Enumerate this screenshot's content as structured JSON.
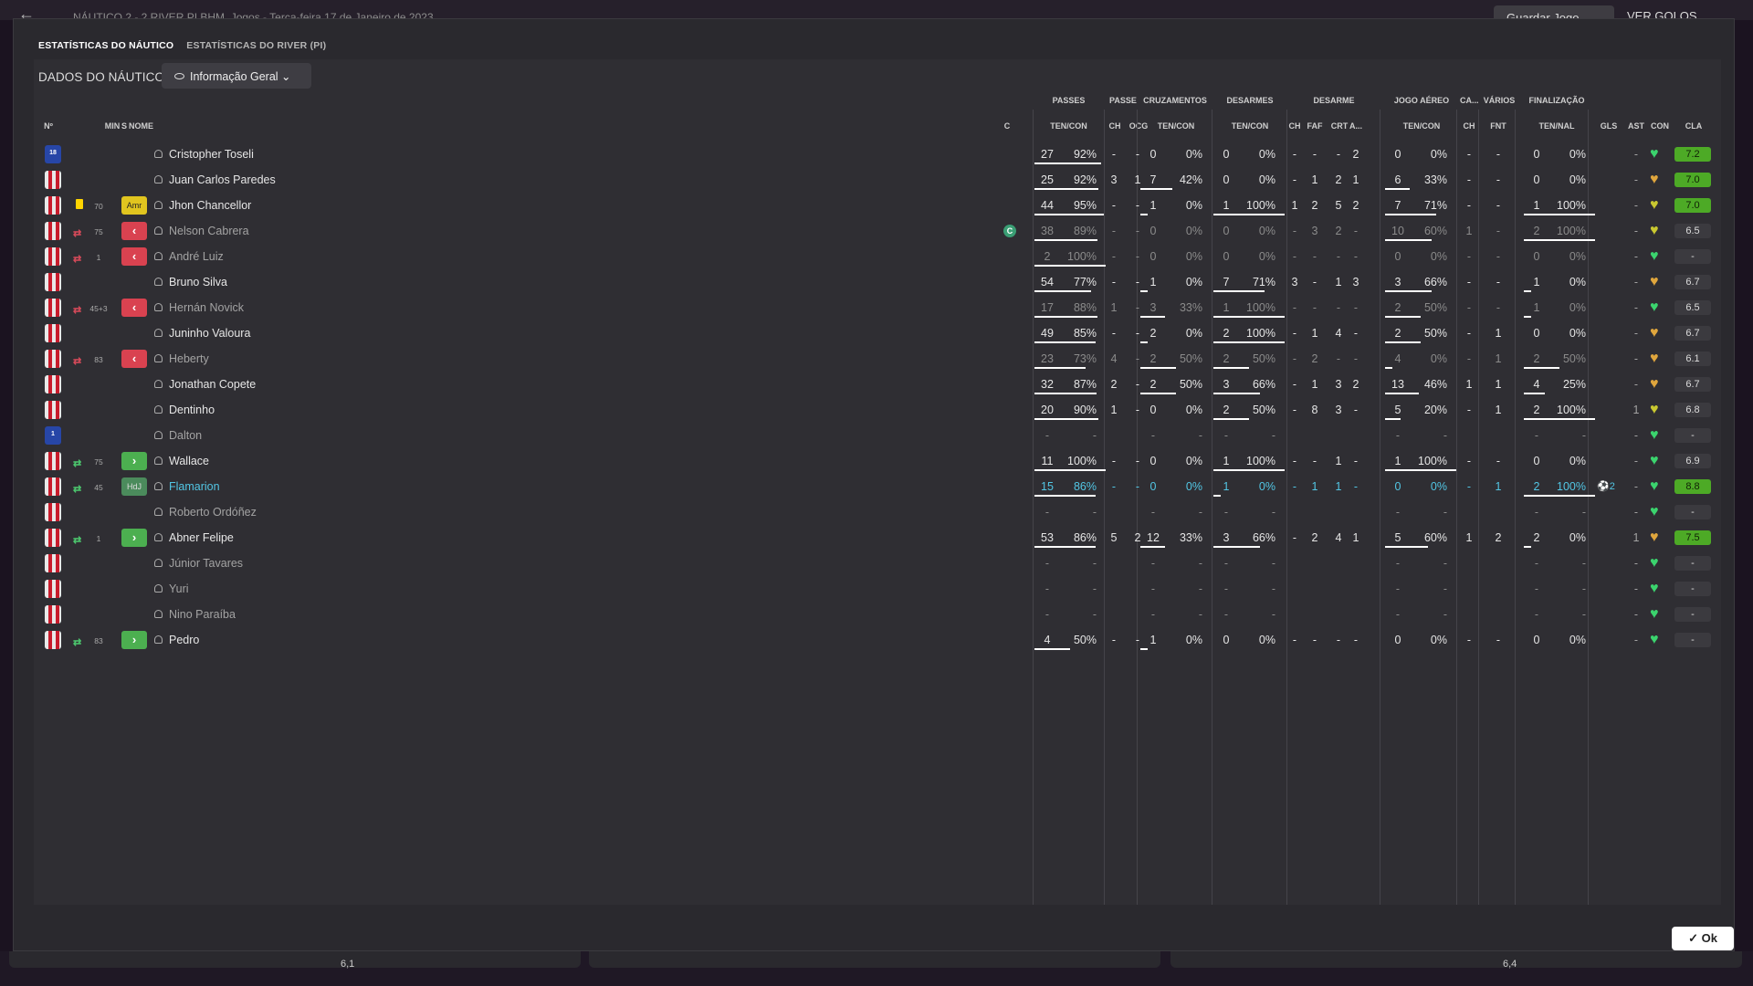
{
  "topbar": {
    "back": "←",
    "match": "NÁUTICO  2 - 2  RIVER PI   BHM, Jogos  -  Terça-feira 17 de Janeiro de 2023",
    "save": "Guardar Jogo",
    "goals": "VER GOLOS"
  },
  "tabs": [
    {
      "label": "ESTATÍSTICAS DO NÁUTICO",
      "active": true
    },
    {
      "label": "ESTATÍSTICAS DO RIVER (PI)",
      "active": false
    }
  ],
  "section_title": "DADOS DO NÁUTICO",
  "view_select": "Informação Geral",
  "group_headers": [
    "PASSES",
    "PASSE",
    "CRUZAMENTOS",
    "DESARMES",
    "DESARME",
    "JOGO AÉREO",
    "CA...",
    "VÁRIOS",
    "FINALIZAÇÃO"
  ],
  "column_headers": [
    "Nº",
    "MIN",
    "S",
    "NOME",
    "C",
    "TEN/CON",
    "CH",
    "OCG",
    "TEN/CON",
    "TEN/CON",
    "CH",
    "FAF",
    "CRT",
    "A...",
    "TEN/CON",
    "CH",
    "FNT",
    "TEN/NAL",
    "GLS",
    "AST",
    "CON",
    "CLA"
  ],
  "players": [
    {
      "num": "18",
      "gk": true,
      "name": "Cristopher Toseli",
      "dim": false,
      "card": "",
      "sub": "",
      "min": "",
      "badge": "",
      "cap": false,
      "pas": [
        "27",
        "92%",
        0.93
      ],
      "ch": "-",
      "ocg": "-",
      "cru": [
        "0",
        "0%",
        0
      ],
      "des": [
        "0",
        "0%",
        0
      ],
      "dch": "-",
      "faf": "-",
      "crt": "-",
      "a": "2",
      "aer": [
        "0",
        "0%",
        0
      ],
      "cach": "-",
      "fnt": "-",
      "fin": [
        "0",
        "0%",
        0
      ],
      "gls": "",
      "ast": "-",
      "heart": "g",
      "cla": "7.2",
      "hi": true
    },
    {
      "num": "",
      "gk": false,
      "name": "Juan Carlos Paredes",
      "dim": false,
      "card": "",
      "sub": "",
      "min": "",
      "badge": "",
      "cap": false,
      "pas": [
        "25",
        "92%",
        0.9
      ],
      "ch": "3",
      "ocg": "1",
      "cru": [
        "7",
        "42%",
        0.45
      ],
      "des": [
        "0",
        "0%",
        0
      ],
      "dch": "-",
      "faf": "1",
      "crt": "2",
      "a": "1",
      "aer": [
        "6",
        "33%",
        0.35
      ],
      "cach": "-",
      "fnt": "-",
      "fin": [
        "0",
        "0%",
        0
      ],
      "gls": "",
      "ast": "-",
      "heart": "o",
      "cla": "7.0",
      "hi": true
    },
    {
      "num": "",
      "gk": false,
      "name": "Jhon Chancellor",
      "dim": false,
      "card": "y",
      "sub": "",
      "min": "70",
      "badge": "Amr",
      "cap": false,
      "pas": [
        "44",
        "95%",
        0.97
      ],
      "ch": "-",
      "ocg": "-",
      "cru": [
        "1",
        "0%",
        0.1
      ],
      "des": [
        "1",
        "100%",
        1
      ],
      "dch": "1",
      "faf": "2",
      "crt": "5",
      "a": "2",
      "aer": [
        "7",
        "71%",
        0.72
      ],
      "cach": "-",
      "fnt": "-",
      "fin": [
        "1",
        "100%",
        1
      ],
      "gls": "",
      "ast": "-",
      "heart": "y",
      "cla": "7.0",
      "hi": true
    },
    {
      "num": "",
      "gk": false,
      "name": "Nelson Cabrera",
      "dim": true,
      "card": "",
      "sub": "out",
      "min": "75",
      "badge": "<",
      "cap": true,
      "pas": [
        "38",
        "89%",
        0.88
      ],
      "ch": "-",
      "ocg": "-",
      "cru": [
        "0",
        "0%",
        0
      ],
      "des": [
        "0",
        "0%",
        0
      ],
      "dch": "-",
      "faf": "3",
      "crt": "2",
      "a": "-",
      "aer": [
        "10",
        "60%",
        0.65
      ],
      "cach": "1",
      "fnt": "-",
      "fin": [
        "2",
        "100%",
        1
      ],
      "gls": "",
      "ast": "-",
      "heart": "y",
      "cla": "6.5",
      "hi": false
    },
    {
      "num": "",
      "gk": false,
      "name": "André Luiz",
      "dim": true,
      "card": "",
      "sub": "out",
      "min": "1",
      "badge": "<",
      "cap": false,
      "pas": [
        "2",
        "100%",
        1
      ],
      "ch": "-",
      "ocg": "-",
      "cru": [
        "0",
        "0%",
        0
      ],
      "des": [
        "0",
        "0%",
        0
      ],
      "dch": "-",
      "faf": "-",
      "crt": "-",
      "a": "-",
      "aer": [
        "0",
        "0%",
        0
      ],
      "cach": "-",
      "fnt": "-",
      "fin": [
        "0",
        "0%",
        0
      ],
      "gls": "",
      "ast": "-",
      "heart": "g",
      "cla": "-",
      "hi": false
    },
    {
      "num": "",
      "gk": false,
      "name": "Bruno Silva",
      "dim": false,
      "card": "",
      "sub": "",
      "min": "",
      "badge": "",
      "cap": false,
      "pas": [
        "54",
        "77%",
        0.8
      ],
      "ch": "-",
      "ocg": "-",
      "cru": [
        "1",
        "0%",
        0.1
      ],
      "des": [
        "7",
        "71%",
        0.72
      ],
      "dch": "3",
      "faf": "-",
      "crt": "1",
      "a": "3",
      "aer": [
        "3",
        "66%",
        0.66
      ],
      "cach": "-",
      "fnt": "-",
      "fin": [
        "1",
        "0%",
        0.1
      ],
      "gls": "",
      "ast": "-",
      "heart": "o",
      "cla": "6.7",
      "hi": false
    },
    {
      "num": "",
      "gk": false,
      "name": "Hernán Novick",
      "dim": true,
      "card": "",
      "sub": "out",
      "min": "45+3",
      "badge": "<",
      "cap": false,
      "pas": [
        "17",
        "88%",
        0.88
      ],
      "ch": "1",
      "ocg": "-",
      "cru": [
        "3",
        "33%",
        0.35
      ],
      "des": [
        "1",
        "100%",
        1
      ],
      "dch": "-",
      "faf": "-",
      "crt": "-",
      "a": "-",
      "aer": [
        "2",
        "50%",
        0.5
      ],
      "cach": "-",
      "fnt": "-",
      "fin": [
        "1",
        "0%",
        0.1
      ],
      "gls": "",
      "ast": "-",
      "heart": "g",
      "cla": "6.5",
      "hi": false
    },
    {
      "num": "",
      "gk": false,
      "name": "Juninho Valoura",
      "dim": false,
      "card": "",
      "sub": "",
      "min": "",
      "badge": "",
      "cap": false,
      "pas": [
        "49",
        "85%",
        0.86
      ],
      "ch": "-",
      "ocg": "-",
      "cru": [
        "2",
        "0%",
        0.1
      ],
      "des": [
        "2",
        "100%",
        1
      ],
      "dch": "-",
      "faf": "1",
      "crt": "4",
      "a": "-",
      "aer": [
        "2",
        "50%",
        0.5
      ],
      "cach": "-",
      "fnt": "1",
      "fin": [
        "0",
        "0%",
        0
      ],
      "gls": "",
      "ast": "-",
      "heart": "o",
      "cla": "6.7",
      "hi": false
    },
    {
      "num": "",
      "gk": false,
      "name": "Heberty",
      "dim": true,
      "card": "",
      "sub": "out",
      "min": "83",
      "badge": "<",
      "cap": false,
      "pas": [
        "23",
        "73%",
        0.72
      ],
      "ch": "4",
      "ocg": "-",
      "cru": [
        "2",
        "50%",
        0.5
      ],
      "des": [
        "2",
        "50%",
        0.5
      ],
      "dch": "-",
      "faf": "2",
      "crt": "-",
      "a": "-",
      "aer": [
        "4",
        "0%",
        0.1
      ],
      "cach": "-",
      "fnt": "1",
      "fin": [
        "2",
        "50%",
        0.5
      ],
      "gls": "",
      "ast": "-",
      "heart": "o",
      "cla": "6.1",
      "hi": false
    },
    {
      "num": "",
      "gk": false,
      "name": "Jonathan Copete",
      "dim": false,
      "card": "",
      "sub": "",
      "min": "",
      "badge": "",
      "cap": false,
      "pas": [
        "32",
        "87%",
        0.87
      ],
      "ch": "2",
      "ocg": "-",
      "cru": [
        "2",
        "50%",
        0.5
      ],
      "des": [
        "3",
        "66%",
        0.66
      ],
      "dch": "-",
      "faf": "1",
      "crt": "3",
      "a": "2",
      "aer": [
        "13",
        "46%",
        0.47
      ],
      "cach": "1",
      "fnt": "1",
      "fin": [
        "4",
        "25%",
        0.3
      ],
      "gls": "",
      "ast": "-",
      "heart": "o",
      "cla": "6.7",
      "hi": false
    },
    {
      "num": "",
      "gk": false,
      "name": "Dentinho",
      "dim": false,
      "card": "",
      "sub": "",
      "min": "",
      "badge": "",
      "cap": false,
      "pas": [
        "20",
        "90%",
        0.9
      ],
      "ch": "1",
      "ocg": "-",
      "cru": [
        "0",
        "0%",
        0
      ],
      "des": [
        "2",
        "50%",
        0.5
      ],
      "dch": "-",
      "faf": "8",
      "crt": "3",
      "a": "-",
      "aer": [
        "5",
        "20%",
        0.22
      ],
      "cach": "-",
      "fnt": "1",
      "fin": [
        "2",
        "100%",
        1
      ],
      "gls": "",
      "ast": "1",
      "heart": "y",
      "cla": "6.8",
      "hi": false
    },
    {
      "num": "1",
      "gk": true,
      "name": "Dalton",
      "dim": true,
      "card": "",
      "sub": "",
      "min": "",
      "badge": "",
      "cap": false,
      "pas": [
        "-",
        "-",
        0
      ],
      "ch": "",
      "ocg": "",
      "cru": [
        "-",
        "-",
        0
      ],
      "des": [
        "-",
        "-",
        0
      ],
      "dch": "",
      "faf": "",
      "crt": "",
      "a": "",
      "aer": [
        "-",
        "-",
        0
      ],
      "cach": "",
      "fnt": "",
      "fin": [
        "-",
        "-",
        0
      ],
      "gls": "",
      "ast": "-",
      "heart": "g",
      "cla": "-",
      "hi": false
    },
    {
      "num": "",
      "gk": false,
      "name": "Wallace",
      "dim": false,
      "card": "",
      "sub": "in",
      "min": "75",
      "badge": ">",
      "cap": false,
      "pas": [
        "11",
        "100%",
        1
      ],
      "ch": "-",
      "ocg": "-",
      "cru": [
        "0",
        "0%",
        0
      ],
      "des": [
        "1",
        "100%",
        1
      ],
      "dch": "-",
      "faf": "-",
      "crt": "1",
      "a": "-",
      "aer": [
        "1",
        "100%",
        1
      ],
      "cach": "-",
      "fnt": "-",
      "fin": [
        "0",
        "0%",
        0
      ],
      "gls": "",
      "ast": "-",
      "heart": "g",
      "cla": "6.9",
      "hi": false
    },
    {
      "num": "",
      "gk": false,
      "name": "Flamarion",
      "dim": false,
      "cyan": true,
      "card": "",
      "sub": "in",
      "min": "45",
      "badge": "HdJ",
      "cap": false,
      "pas": [
        "15",
        "86%",
        0.86
      ],
      "ch": "-",
      "ocg": "-",
      "cru": [
        "0",
        "0%",
        0
      ],
      "des": [
        "1",
        "0%",
        0.1
      ],
      "dch": "-",
      "faf": "1",
      "crt": "1",
      "a": "-",
      "aer": [
        "0",
        "0%",
        0
      ],
      "cach": "-",
      "fnt": "1",
      "fin": [
        "2",
        "100%",
        1
      ],
      "gls": "⚽2",
      "ast": "-",
      "heart": "g",
      "cla": "8.8",
      "hi": true
    },
    {
      "num": "",
      "gk": false,
      "name": "Roberto Ordóñez",
      "dim": true,
      "card": "",
      "sub": "",
      "min": "",
      "badge": "",
      "cap": false,
      "pas": [
        "-",
        "-",
        0
      ],
      "ch": "",
      "ocg": "",
      "cru": [
        "-",
        "-",
        0
      ],
      "des": [
        "-",
        "-",
        0
      ],
      "dch": "",
      "faf": "",
      "crt": "",
      "a": "",
      "aer": [
        "-",
        "-",
        0
      ],
      "cach": "",
      "fnt": "",
      "fin": [
        "-",
        "-",
        0
      ],
      "gls": "",
      "ast": "-",
      "heart": "g",
      "cla": "-",
      "hi": false
    },
    {
      "num": "",
      "gk": false,
      "name": "Abner Felipe",
      "dim": false,
      "card": "",
      "sub": "in",
      "min": "1",
      "badge": ">",
      "cap": false,
      "pas": [
        "53",
        "86%",
        0.86
      ],
      "ch": "5",
      "ocg": "2",
      "cru": [
        "12",
        "33%",
        0.35
      ],
      "des": [
        "3",
        "66%",
        0.66
      ],
      "dch": "-",
      "faf": "2",
      "crt": "4",
      "a": "1",
      "aer": [
        "5",
        "60%",
        0.6
      ],
      "cach": "1",
      "fnt": "2",
      "fin": [
        "2",
        "0%",
        0.1
      ],
      "gls": "",
      "ast": "1",
      "heart": "o",
      "cla": "7.5",
      "hi": true
    },
    {
      "num": "",
      "gk": false,
      "name": "Júnior Tavares",
      "dim": true,
      "card": "",
      "sub": "",
      "min": "",
      "badge": "",
      "cap": false,
      "pas": [
        "-",
        "-",
        0
      ],
      "ch": "",
      "ocg": "",
      "cru": [
        "-",
        "-",
        0
      ],
      "des": [
        "-",
        "-",
        0
      ],
      "dch": "",
      "faf": "",
      "crt": "",
      "a": "",
      "aer": [
        "-",
        "-",
        0
      ],
      "cach": "",
      "fnt": "",
      "fin": [
        "-",
        "-",
        0
      ],
      "gls": "",
      "ast": "-",
      "heart": "g",
      "cla": "-",
      "hi": false
    },
    {
      "num": "",
      "gk": false,
      "name": "Yuri",
      "dim": true,
      "card": "",
      "sub": "",
      "min": "",
      "badge": "",
      "cap": false,
      "pas": [
        "-",
        "-",
        0
      ],
      "ch": "",
      "ocg": "",
      "cru": [
        "-",
        "-",
        0
      ],
      "des": [
        "-",
        "-",
        0
      ],
      "dch": "",
      "faf": "",
      "crt": "",
      "a": "",
      "aer": [
        "-",
        "-",
        0
      ],
      "cach": "",
      "fnt": "",
      "fin": [
        "-",
        "-",
        0
      ],
      "gls": "",
      "ast": "-",
      "heart": "g",
      "cla": "-",
      "hi": false
    },
    {
      "num": "",
      "gk": false,
      "name": "Nino Paraíba",
      "dim": true,
      "card": "",
      "sub": "",
      "min": "",
      "badge": "",
      "cap": false,
      "pas": [
        "-",
        "-",
        0
      ],
      "ch": "",
      "ocg": "",
      "cru": [
        "-",
        "-",
        0
      ],
      "des": [
        "-",
        "-",
        0
      ],
      "dch": "",
      "faf": "",
      "crt": "",
      "a": "",
      "aer": [
        "-",
        "-",
        0
      ],
      "cach": "",
      "fnt": "",
      "fin": [
        "-",
        "-",
        0
      ],
      "gls": "",
      "ast": "-",
      "heart": "g",
      "cla": "-",
      "hi": false
    },
    {
      "num": "",
      "gk": false,
      "name": "Pedro",
      "dim": false,
      "card": "",
      "sub": "in",
      "min": "83",
      "badge": ">",
      "cap": false,
      "pas": [
        "4",
        "50%",
        0.5
      ],
      "ch": "-",
      "ocg": "-",
      "cru": [
        "1",
        "0%",
        0.1
      ],
      "des": [
        "0",
        "0%",
        0
      ],
      "dch": "-",
      "faf": "-",
      "crt": "-",
      "a": "-",
      "aer": [
        "0",
        "0%",
        0
      ],
      "cach": "-",
      "fnt": "-",
      "fin": [
        "0",
        "0%",
        0
      ],
      "gls": "",
      "ast": "-",
      "heart": "g",
      "cla": "-",
      "hi": false
    }
  ],
  "ok": "Ok",
  "bottom": {
    "left": "6,1",
    "right": "6,4"
  }
}
